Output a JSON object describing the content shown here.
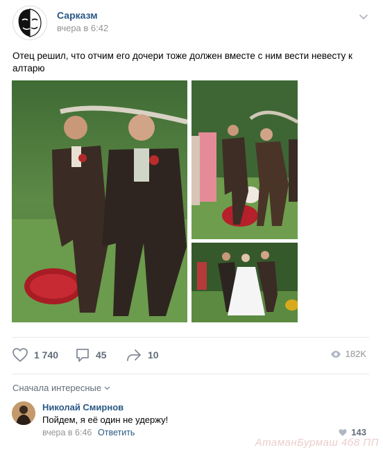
{
  "post": {
    "author": "Сарказм",
    "time": "вчера в 6:42",
    "text": "Отец решил, что отчим его дочери тоже должен вместе с ним вести невесту к алтарю"
  },
  "photos": [
    {
      "name": "two-men-walking-photo"
    },
    {
      "name": "aisle-wide-photo"
    },
    {
      "name": "bride-escort-photo"
    }
  ],
  "actions": {
    "likes": "1 740",
    "comments": "45",
    "shares": "10",
    "views": "182K"
  },
  "comments_section": {
    "sort_label": "Сначала интересные",
    "items": [
      {
        "author": "Николай Смирнов",
        "text": "Пойдем, я её один не удержу!",
        "time": "вчера в 6:46",
        "reply_label": "Ответить",
        "likes": "143"
      }
    ]
  },
  "watermark": "АтаманБурмаш 4б8 ПП",
  "colors": {
    "link": "#2a5885",
    "muted": "#939393",
    "icon": "#828a99",
    "divider": "#e7e8ec"
  },
  "icons": {
    "avatar": "sarcasm-logo-icon",
    "menu": "chevron-down-icon",
    "like": "heart-icon",
    "comment": "comment-bubble-icon",
    "share": "share-arrow-icon",
    "views": "eye-icon"
  }
}
